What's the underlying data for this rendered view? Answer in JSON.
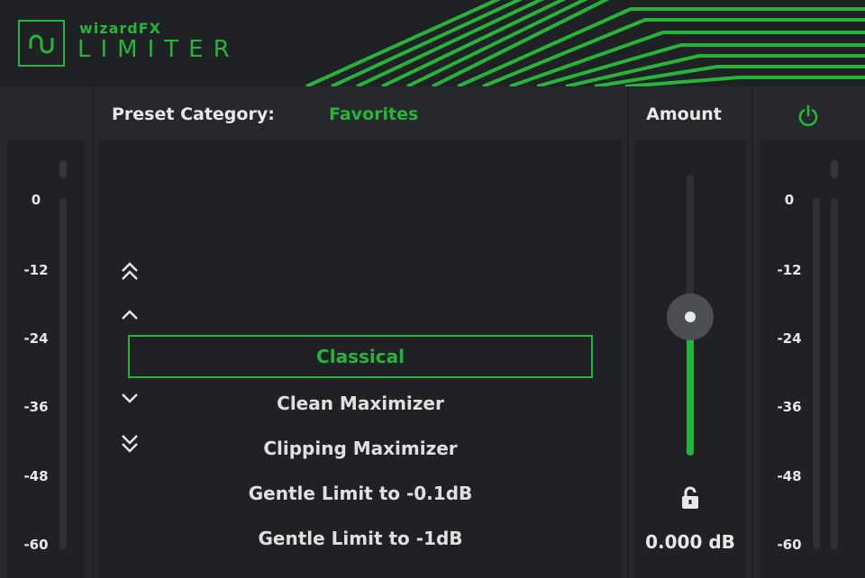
{
  "header": {
    "brand": "wizardFX",
    "product": "LIMITER",
    "accent_color": "#26b53a",
    "logo_icon": "waveform-logo-icon"
  },
  "preset": {
    "category_label": "Preset Category:",
    "category_value": "Favorites",
    "items": [
      {
        "label": "Classical",
        "selected": true
      },
      {
        "label": "Clean Maximizer",
        "selected": false
      },
      {
        "label": "Clipping Maximizer",
        "selected": false
      },
      {
        "label": "Gentle Limit to -0.1dB",
        "selected": false
      },
      {
        "label": "Gentle Limit to -1dB",
        "selected": false
      }
    ],
    "nav_icons": [
      "double-chevron-up-icon",
      "chevron-up-icon",
      "chevron-down-icon",
      "double-chevron-down-icon"
    ]
  },
  "amount": {
    "label": "Amount",
    "value_text": "0.000 dB",
    "slider_level": 0.5,
    "lock_icon": "unlocked-padlock-icon"
  },
  "power": {
    "icon": "power-icon"
  },
  "meters": {
    "scale": [
      "0",
      "-12",
      "-24",
      "-36",
      "-48",
      "-60"
    ]
  }
}
